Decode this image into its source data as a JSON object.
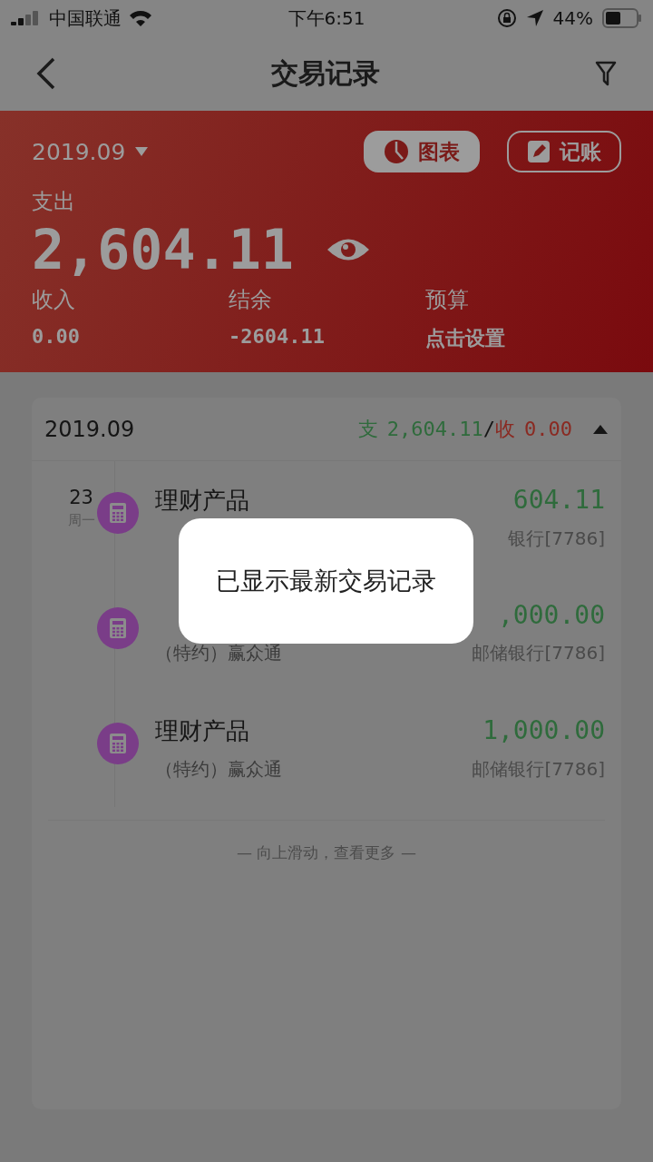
{
  "status_bar": {
    "carrier": "中国联通",
    "time": "下午6:51",
    "battery": "44%"
  },
  "nav": {
    "title": "交易记录"
  },
  "summary": {
    "month": "2019.09",
    "buttons": [
      {
        "label": "图表",
        "kind": "chart"
      },
      {
        "label": "记账",
        "kind": "edit"
      }
    ],
    "expense_label": "支出",
    "expense": "2,604.11",
    "stats": [
      {
        "label": "收入",
        "value": "0.00"
      },
      {
        "label": "结余",
        "value": "-2604.11"
      },
      {
        "label": "预算",
        "value": "点击设置"
      }
    ]
  },
  "group": {
    "month": "2019.09",
    "out_label": "支",
    "out_value": "2,604.11",
    "separator": "/",
    "in_label": "收",
    "in_value": "0.00",
    "expanded": true,
    "day": {
      "date": "23",
      "weekday": "周一"
    },
    "transactions": [
      {
        "title": "理财产品",
        "amount": "604.11",
        "account": "银行[7786]"
      },
      {
        "amount": ",000.00",
        "subtitle": "（特约）赢众通",
        "account": "邮储银行[7786]"
      },
      {
        "title": "理财产品",
        "amount": "1,000.00",
        "subtitle": "（特约）赢众通",
        "account": "邮储银行[7786]"
      }
    ],
    "footer": "— 向上滑动，查看更多 —"
  },
  "toast": "已显示最新交易记录"
}
